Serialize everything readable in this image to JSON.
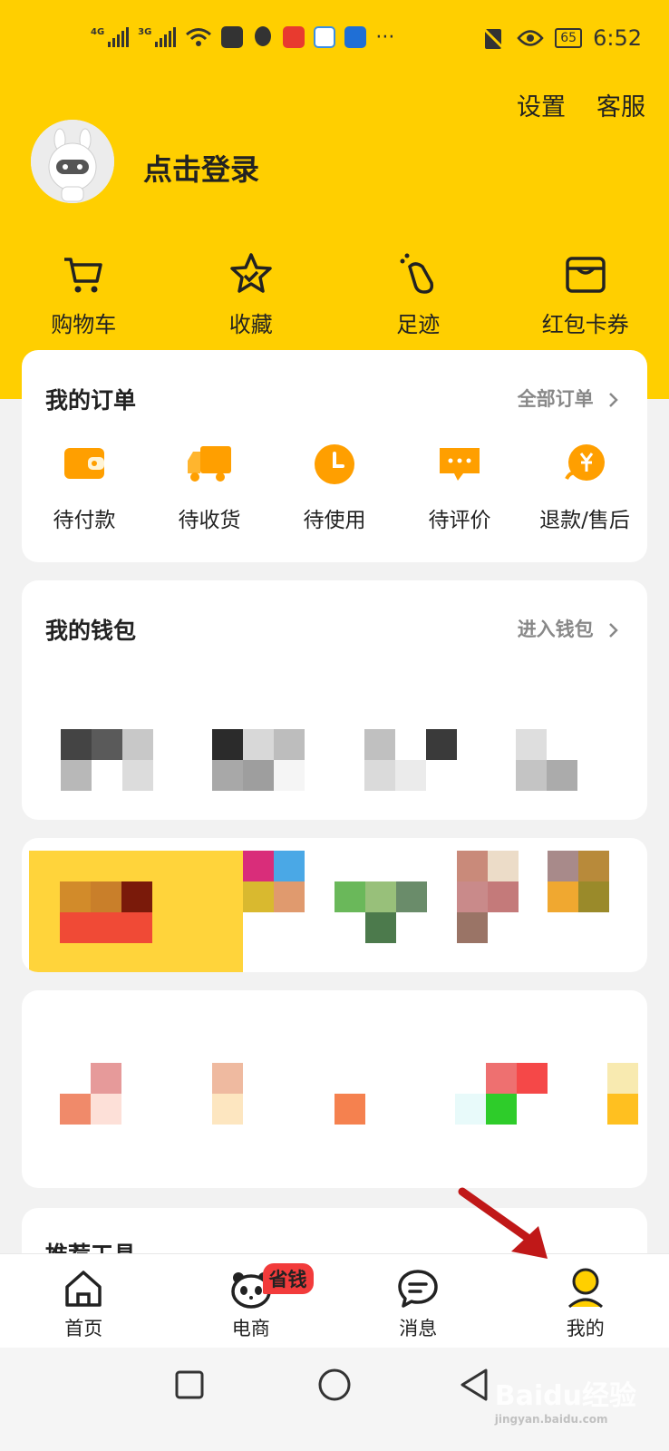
{
  "status_bar": {
    "net1": "4G",
    "net2": "3G",
    "wifi_tag": "4+",
    "more": "···",
    "battery": "65",
    "time": "6:52"
  },
  "header": {
    "settings": "设置",
    "service": "客服",
    "login": "点击登录"
  },
  "shortcuts": [
    {
      "label": "购物车",
      "icon": "cart-icon"
    },
    {
      "label": "收藏",
      "icon": "star-icon"
    },
    {
      "label": "足迹",
      "icon": "footprint-icon"
    },
    {
      "label": "红包卡券",
      "icon": "wallet-card-icon"
    }
  ],
  "orders_card": {
    "title": "我的订单",
    "link": "全部订单",
    "items": [
      {
        "label": "待付款",
        "icon": "wallet-icon"
      },
      {
        "label": "待收货",
        "icon": "truck-icon"
      },
      {
        "label": "待使用",
        "icon": "clock-icon"
      },
      {
        "label": "待评价",
        "icon": "comment-icon"
      },
      {
        "label": "退款/售后",
        "icon": "refund-icon"
      }
    ]
  },
  "wallet_card": {
    "title": "我的钱包",
    "link": "进入钱包"
  },
  "tools_card": {
    "title": "推荐工具"
  },
  "bottom_nav": [
    {
      "label": "首页",
      "icon": "home-icon"
    },
    {
      "label": "电商",
      "icon": "panda-icon",
      "badge": "省钱"
    },
    {
      "label": "消息",
      "icon": "message-icon"
    },
    {
      "label": "我的",
      "icon": "profile-icon"
    }
  ],
  "watermark": {
    "text": "Baidu经验",
    "sub": "jingyan.baidu.com"
  },
  "colors": {
    "brand": "#ffcf00",
    "accent": "#ff9f00",
    "badge": "#f23b3b"
  }
}
